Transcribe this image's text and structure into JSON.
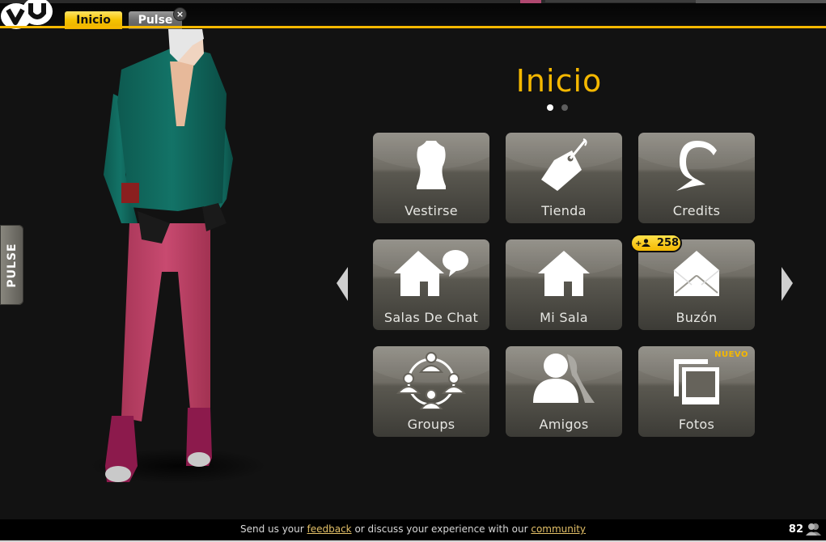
{
  "app": {
    "logo": "vu-logo",
    "accent_color": "#f5b800"
  },
  "tabs": [
    {
      "label": "Inicio",
      "active": true
    },
    {
      "label": "Pulse",
      "active": false,
      "closable": true
    }
  ],
  "tab_close_glyph": "×",
  "side_tab": {
    "label": "PULSE"
  },
  "main": {
    "title": "Inicio",
    "pages": {
      "count": 2,
      "current": 1
    },
    "tiles": [
      {
        "label": "Vestirse",
        "icon": "mannequin-icon"
      },
      {
        "label": "Tienda",
        "icon": "price-tag-icon"
      },
      {
        "label": "Credits",
        "icon": "credits-icon"
      },
      {
        "label": "Salas De Chat",
        "icon": "chat-house-icon"
      },
      {
        "label": "Mi Sala",
        "icon": "house-icon"
      },
      {
        "label": "Buzón",
        "icon": "envelope-icon"
      },
      {
        "label": "Groups",
        "icon": "groups-icon"
      },
      {
        "label": "Amigos",
        "icon": "friends-icon"
      },
      {
        "label": "Fotos",
        "icon": "photos-icon"
      }
    ],
    "buzon_badge": {
      "prefix": "+",
      "icon": "person-icon",
      "count": "258"
    },
    "fotos_tag": "NUEVO"
  },
  "footer": {
    "text_before": "Send us your ",
    "feedback_link": "feedback",
    "text_middle": " or discuss your experience with our ",
    "community_link": "community",
    "online_count": "82"
  }
}
